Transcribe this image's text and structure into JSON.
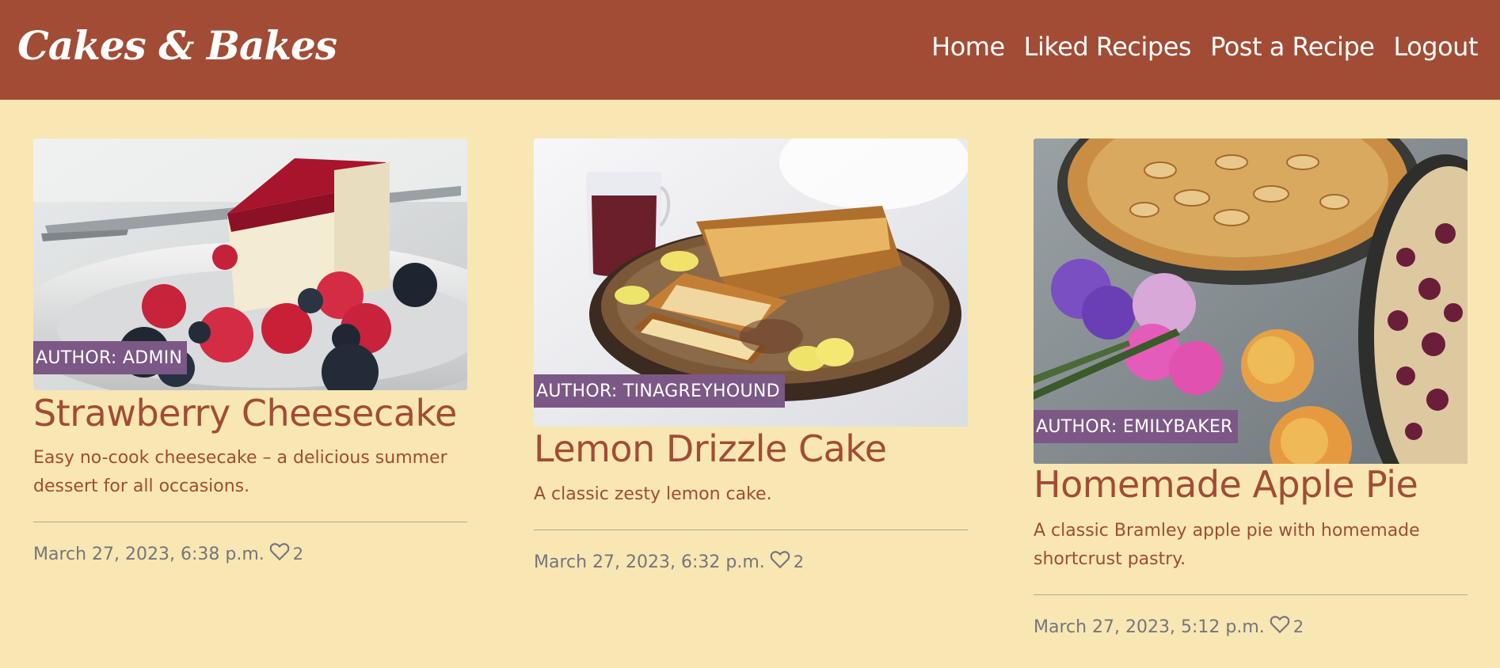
{
  "navbar": {
    "brand": "Cakes & Bakes",
    "links": [
      {
        "label": "Home"
      },
      {
        "label": "Liked Recipes"
      },
      {
        "label": "Post a Recipe"
      },
      {
        "label": "Logout"
      }
    ]
  },
  "recipes": [
    {
      "image_icon": "cheesecake-image",
      "author_label": "AUTHOR: ADMIN",
      "title": "Strawberry Cheesecake",
      "description": "Easy no-cook cheesecake – a delicious summer dessert for all occasions.",
      "date": "March 27, 2023, 6:38 p.m.",
      "likes": "2"
    },
    {
      "image_icon": "lemon-cake-image",
      "author_label": "AUTHOR: TINAGREYHOUND",
      "title": "Lemon Drizzle Cake",
      "description": "A classic zesty lemon cake.",
      "date": "March 27, 2023, 6:32 p.m.",
      "likes": "2"
    },
    {
      "image_icon": "apple-pie-image",
      "author_label": "AUTHOR: EMILYBAKER",
      "title": "Homemade Apple Pie",
      "description": "A classic Bramley apple pie with homemade shortcrust pastry.",
      "date": "March 27, 2023, 5:12 p.m.",
      "likes": "2"
    }
  ],
  "colors": {
    "navbar_bg": "#a24c36",
    "page_bg": "#f8e7b3",
    "accent_text": "#a24c36",
    "author_badge_bg": "#7c5886",
    "meta_text": "#75757b"
  }
}
